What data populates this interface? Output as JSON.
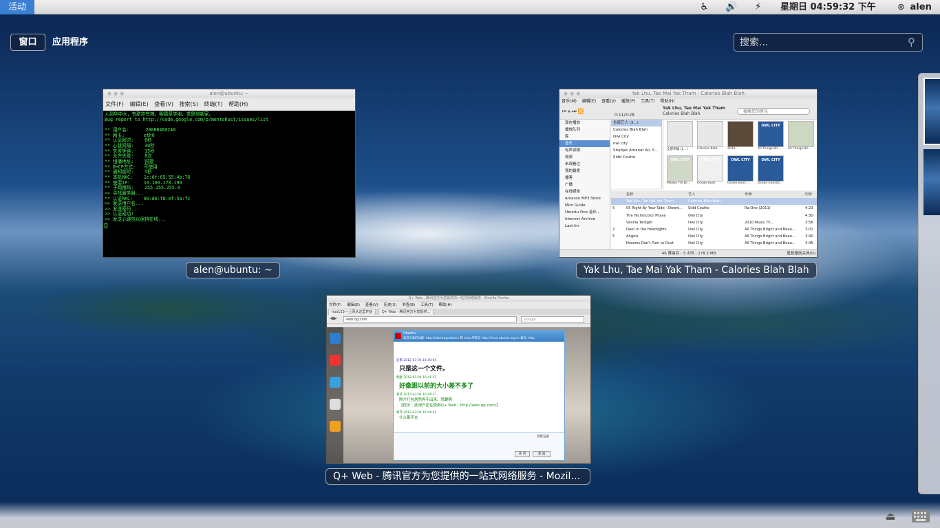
{
  "top_panel": {
    "activities_label": "活动",
    "clock": "星期日 04:59:32 下午",
    "user_name": "alen",
    "icons": [
      "accessibility-icon",
      "volume-icon",
      "network-icon",
      "user-status-icon"
    ]
  },
  "overview": {
    "windows_button": "窗口",
    "applications_button": "应用程序",
    "search_placeholder": "搜索..."
  },
  "terminal": {
    "title": "alen@ubuntu: ~",
    "caption": "alen@ubuntu: ~",
    "menu": [
      "文件(F)",
      "编辑(E)",
      "查看(V)",
      "搜索(S)",
      "终端(T)",
      "帮助(H)"
    ],
    "lines": [
      "人到华中大，有甜亦有辣。明德厚学地，求是创新家。",
      "Bug report to http://code.google.com/p/mentohust/issues/list",
      "",
      "** 用户名:      20088460240",
      "** 网卡:       eth0",
      "** 认证超时:    8秒",
      "** 心跳间隔:    30秒",
      "** 失败等待:    15秒",
      "** 允许失败:    8次",
      "** 组播地址:    锐捷",
      "** DHCP方式:   不使用",
      "** 通知超时:    5秒",
      "** 本机MAC:    1c:6f:65:55:4b:76",
      "** 使用IP:     10.100.170.190",
      "** 子网掩码:    255.255.255.0",
      ">> 寻找服务器...",
      "** 认证MAC:    00:d0:f8:ef:5a:fc",
      ">> 发送用户名...",
      ">> 发送密码...",
      ">> 认证成功!",
      ">> 发送心跳包以保持在线..."
    ]
  },
  "music": {
    "title": "Yak Lhu, Tae Mai Yak Tham - Calories Blah Blah",
    "caption": "Yak Lhu, Tae Mai Yak Tham - Calories Blah Blah",
    "menu": [
      "音乐(M)",
      "编辑(E)",
      "查看(V)",
      "播放(P)",
      "工具(T)",
      "帮助(H)"
    ],
    "now_playing_title": "Yak Lhu, Tae Mai Yak Tham",
    "now_playing_sub": "Calories Blah Blah",
    "time": "0:11/3:28",
    "search_placeholder": "搜索您的音乐",
    "sidebar": [
      "现在播放",
      "播放队列",
      "库",
      "音乐",
      "有声读物",
      "视频",
      "未观看过",
      "我的最爱",
      "播客",
      "广播",
      "在线媒体",
      "Amazon MP3 Store",
      "Miro Guide",
      "Ubuntu One 音乐...",
      "Internet Archive",
      "Last.fm"
    ],
    "artists": [
      "全部艺人 (3...)",
      "Calories Blah Blah",
      "Owl City",
      "owl city",
      "Shafqat Amanat Ali, S...",
      "Sidd Coutto"
    ],
    "albums": [
      "全部专辑 (1...)",
      "Calories Blah ...",
      "2010...",
      "All Things Bri...",
      "All Things Bri...",
      "Maybe I'm Dr...",
      "Ocean Eyes",
      "Ocean Eyes (...",
      "Ocean Eyes(D..."
    ],
    "album_owl_text": "OWL CITY",
    "track_headers": [
      "名称",
      "艺人",
      "专辑",
      "时长"
    ],
    "tracks": [
      {
        "no": "",
        "name": "Yak Lhu, Tae Mai Yak Tham",
        "artist": "Calories Blah Blah",
        "album": "",
        "time": ""
      },
      {
        "no": "5",
        "name": "05 Right By Your Side - Downl...",
        "artist": "Sidd Coutto",
        "album": "Ra.One (2011)",
        "time": "4:23"
      },
      {
        "no": "",
        "name": "The Technicolor Phase",
        "artist": "Owl City",
        "album": "",
        "time": "4:30"
      },
      {
        "no": "",
        "name": "Vanilla Twilight",
        "artist": "Owl City",
        "album": "2010 Music Th...",
        "time": "3:56"
      },
      {
        "no": "2",
        "name": "Deer In the Headlights",
        "artist": "Owl City",
        "album": "All Things Bright and Beau...",
        "time": "3:01"
      },
      {
        "no": "5",
        "name": "Angels",
        "artist": "Owl City",
        "album": "All Things Bright and Beau...",
        "time": "3:40"
      },
      {
        "no": "",
        "name": "Dreams Don't Turn to Dust",
        "artist": "Owl City",
        "album": "All Things Bright and Beau...",
        "time": "3:45"
      }
    ],
    "status": "46 首曲目 - 3 小时 - 278.2 MB",
    "status_right": "重复播放关闭(O)"
  },
  "firefox": {
    "title": "Q+ Web - 腾讯官方为您提供的一站式网络服务 - Mozilla Firefox",
    "caption": "Q+ Web - 腾讯官方为您提供的一站式网络服务 - Mozilla Fi...",
    "menu": [
      "文件(F)",
      "编辑(E)",
      "查看(V)",
      "历史(S)",
      "书签(B)",
      "工具(T)",
      "帮助(H)"
    ],
    "tabs": [
      "hao123---上网从这里开始",
      "Q+ Web - 腾讯官方为您提供..."
    ],
    "url": "web.qq.com",
    "search_engine": "Google",
    "chat_name": "Ubuntu",
    "chat_notice": "欢迎大家的加群: http://ubuntuguidance 和 Linux导航与 http://linux.ubuntu.org.cn 群号: http",
    "messages": [
      {
        "meta": "启南 2012-03-04 16:40:04",
        "text": "只是这一个文件。",
        "style": "big"
      },
      {
        "meta": "明星 2012-03-04 16:41:41",
        "text": "好像跟以前的大小差不多了",
        "style": "big-green"
      },
      {
        "meta": "翠芹 2012-03-04 16:44:37",
        "text": "刚才打包居然弄不出来。思翻啊",
        "style": "small"
      },
      {
        "meta": "",
        "text": "【提示：此用户正在使用Q+ Web：http://web.qq.com/】",
        "style": "small"
      },
      {
        "meta": "翠芹 2012-03-04 16:44:42",
        "text": "什么都不去",
        "style": "small"
      }
    ],
    "history_label": "消息记录",
    "close_label": "关 闭",
    "send_label": "发 送"
  }
}
